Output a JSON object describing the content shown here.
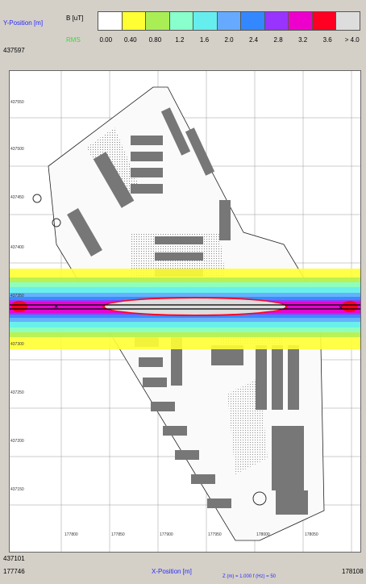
{
  "header": {
    "y_axis_label": "Y-Position [m]",
    "y_max": "437597",
    "y_min": "437101",
    "x_min": "177746",
    "x_max": "178108",
    "x_axis_label": "X-Position [m]",
    "footer": "Z (m) = 1.000    f (Hz) = 50"
  },
  "legend": {
    "unit": "B [uT]",
    "rms": "RMS",
    "colors": [
      "#ffffff",
      "#ffff33",
      "#aaee55",
      "#88ffcc",
      "#66eeee",
      "#66aaff",
      "#3388ff",
      "#9933ff",
      "#ee00cc",
      "#ff0022",
      "#dddddd"
    ],
    "labels": [
      "0.00",
      "0.40",
      "0.80",
      "1.2",
      "1.6",
      "2.0",
      "2.4",
      "2.8",
      "3.2",
      "3.6",
      "> 4.0"
    ]
  },
  "plot": {
    "y_ticks": [
      "437550",
      "437500",
      "437450",
      "437400",
      "437350",
      "437300",
      "437250",
      "437200",
      "437150"
    ],
    "x_ticks": [
      "177800",
      "177850",
      "177900",
      "177950",
      "178000",
      "178050"
    ]
  }
}
